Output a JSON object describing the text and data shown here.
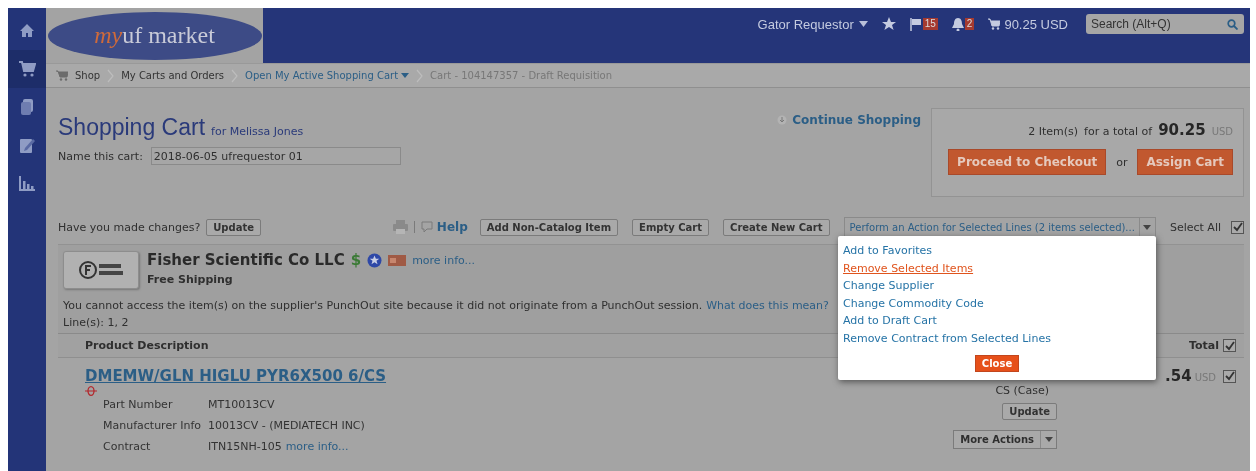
{
  "sidebar": {
    "items": [
      {
        "kind": "home",
        "selected": false
      },
      {
        "kind": "cart",
        "selected": true
      },
      {
        "kind": "documents",
        "selected": false
      },
      {
        "kind": "edit",
        "selected": false
      },
      {
        "kind": "chart",
        "selected": false
      }
    ]
  },
  "header": {
    "logo": {
      "prefix": "my",
      "name": "uf market"
    },
    "user": "Gator Requestor",
    "flag_count": "15",
    "bell_count": "2",
    "cart_total": "90.25 USD",
    "search": {
      "placeholder": "Search (Alt+Q)"
    }
  },
  "breadcrumb": [
    {
      "label": "Shop",
      "kind": "plain"
    },
    {
      "label": "My Carts and Orders",
      "kind": "plain"
    },
    {
      "label": "Open My Active Shopping Cart",
      "kind": "dropdown"
    },
    {
      "label": "Cart - 104147357 - Draft Requisition",
      "kind": "current"
    }
  ],
  "cart": {
    "title": "Shopping Cart",
    "owner": "for Melissa Jones",
    "continue": "Continue Shopping",
    "name_label": "Name this cart:",
    "name_value": "2018-06-05 ufrequestor 01"
  },
  "summary": {
    "items": "2 Item(s)",
    "total_label": "for a total of",
    "total": "90.25",
    "currency": "USD",
    "checkout": "Proceed to Checkout",
    "or": "or",
    "assign": "Assign Cart"
  },
  "toolbar": {
    "changes": "Have you made changes?",
    "update": "Update",
    "help": "Help",
    "buttons": [
      "Add Non-Catalog Item",
      "Empty Cart",
      "Create New Cart"
    ],
    "action": "Perform an Action for Selected Lines (2 items selected)...",
    "select_all": "Select All",
    "select_all_checked": true
  },
  "action_menu": {
    "items": [
      {
        "label": "Add to Favorites",
        "highlighted": false
      },
      {
        "label": "Remove Selected Items",
        "highlighted": true
      },
      {
        "label": "Change Supplier",
        "highlighted": false
      },
      {
        "label": "Change Commodity Code",
        "highlighted": false
      },
      {
        "label": "Add to Draft Cart",
        "highlighted": false
      },
      {
        "label": "Remove Contract from Selected Lines",
        "highlighted": false
      }
    ],
    "close": "Close"
  },
  "supplier": {
    "name": "Fisher Scientific Co LLC",
    "dollar": "$",
    "more_info": "more info...",
    "shipping": "Free Shipping",
    "notice": "You cannot access the item(s) on the supplier's PunchOut site because it did not originate from a PunchOut session.",
    "notice_link": "What does this mean?",
    "lines": "Line(s): 1, 2"
  },
  "table": {
    "columns": [
      {
        "label": "Product Description"
      },
      {
        "label": "Total",
        "checked": true
      }
    ],
    "rows": [
      {
        "title": "DMEMW/GLN HIGLU PYR6X500 6/CS",
        "details": [
          {
            "label": "Part Number",
            "value": "MT10013CV"
          },
          {
            "label": "Manufacturer Info",
            "value": "10013CV - (MEDIATECH INC)"
          },
          {
            "label": "Contract",
            "value": "ITN15NH-105",
            "link": "more info..."
          }
        ],
        "total": ".54",
        "currency": "USD",
        "checked": true,
        "unit": "CS (Case)",
        "update": "Update",
        "more_actions": "More Actions"
      }
    ]
  }
}
